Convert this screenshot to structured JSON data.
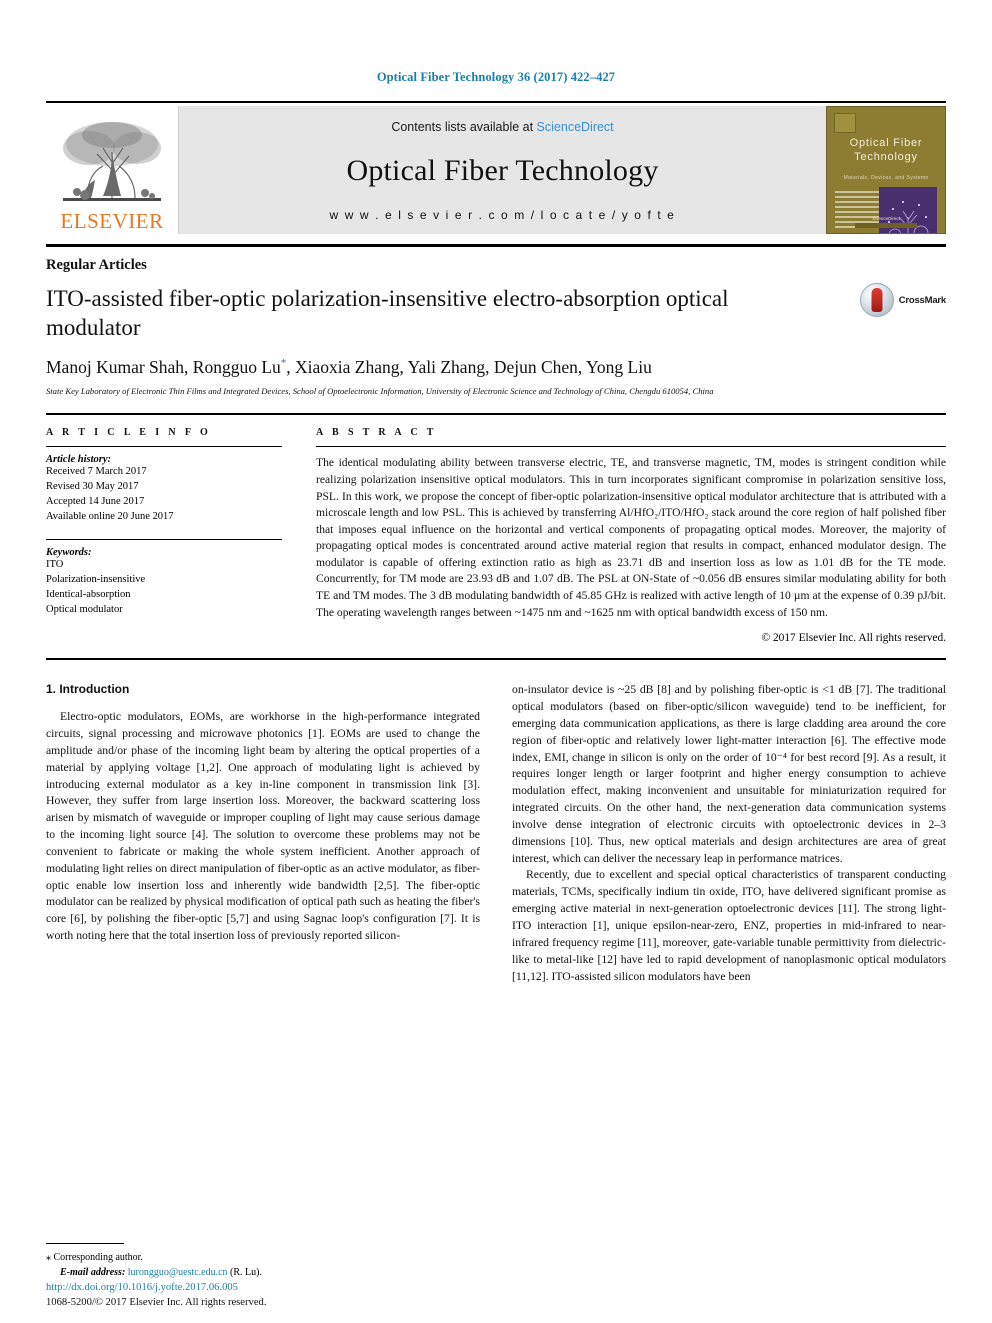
{
  "running_head": "Optical Fiber Technology 36 (2017) 422–427",
  "masthead": {
    "publisher_name": "ELSEVIER",
    "contents_prefix": "Contents lists available at ",
    "contents_link": "ScienceDirect",
    "journal_name": "Optical Fiber Technology",
    "journal_url": "w w w . e l s e v i e r . c o m / l o c a t e / y o f t e",
    "cover": {
      "title_line1": "Optical  Fiber",
      "title_line2": "Technology",
      "subtitle": "Materials, Devices, and Systems",
      "footer": "ScienceDirect"
    }
  },
  "article": {
    "kicker": "Regular Articles",
    "title": "ITO-assisted fiber-optic polarization-insensitive electro-absorption optical modulator",
    "crossmark_label": "CrossMark",
    "authors_pre": "Manoj Kumar Shah, Rongguo Lu",
    "authors_star": "*",
    "authors_post": ", Xiaoxia Zhang, Yali Zhang, Dejun Chen, Yong Liu",
    "affiliation": "State Key Laboratory of Electronic Thin Films and Integrated Devices, School of Optoelectronic Information, University of Electronic Science and Technology of China, Chengdu 610054, China"
  },
  "info": {
    "heading": "A R T I C L E   I N F O",
    "history_label": "Article history:",
    "history": [
      "Received 7 March 2017",
      "Revised 30 May 2017",
      "Accepted 14 June 2017",
      "Available online 20 June 2017"
    ],
    "keywords_label": "Keywords:",
    "keywords": [
      "ITO",
      "Polarization-insensitive",
      "Identical-absorption",
      "Optical modulator"
    ]
  },
  "abstract": {
    "heading": "A B S T R A C T",
    "body": "The identical modulating ability between transverse electric, TE, and transverse magnetic, TM, modes is stringent condition while realizing polarization insensitive optical modulators. This in turn incorporates significant compromise in polarization sensitive loss, PSL. In this work, we propose the concept of fiber-optic polarization-insensitive optical modulator architecture that is attributed with a microscale length and low PSL. This is achieved by transferring Al/HfO₂/ITO/HfO₂ stack around the core region of half polished fiber that imposes equal influence on the horizontal and vertical components of propagating optical modes. Moreover, the majority of propagating optical modes is concentrated around active material region that results in compact, enhanced modulator design. The modulator is capable of offering extinction ratio as high as 23.71 dB and insertion loss as low as 1.01 dB for the TE mode. Concurrently, for TM mode are 23.93 dB and 1.07 dB. The PSL at ON-State of ~0.056 dB ensures similar modulating ability for both TE and TM modes. The 3 dB modulating bandwidth of 45.85 GHz is realized with active length of 10 µm at the expense of 0.39 pJ/bit. The operating wavelength ranges between ~1475 nm and ~1625 nm with optical bandwidth excess of 150 nm.",
    "copyright": "© 2017 Elsevier Inc. All rights reserved."
  },
  "body": {
    "section1_title": "1. Introduction",
    "left_paragraphs": [
      "Electro-optic modulators, EOMs, are workhorse in the high-performance integrated circuits, signal processing and microwave photonics [1]. EOMs are used to change the amplitude and/or phase of the incoming light beam by altering the optical properties of a material by applying voltage [1,2]. One approach of modulating light is achieved by introducing external modulator as a key in-line component in transmission link [3]. However, they suffer from large insertion loss. Moreover, the backward scattering loss arisen by mismatch of waveguide or improper coupling of light may cause serious damage to the incoming light source [4]. The solution to overcome these problems may not be convenient to fabricate or making the whole system inefficient. Another approach of modulating light relies on direct manipulation of fiber-optic as an active modulator, as fiber-optic enable low insertion loss and inherently wide bandwidth [2,5]. The fiber-optic modulator can be realized by physical modification of optical path such as heating the fiber's core [6], by polishing the fiber-optic [5,7] and using Sagnac loop's configuration [7]. It is worth noting here that the total insertion loss of previously reported silicon-"
    ],
    "right_paragraphs": [
      "on-insulator device is ~25 dB [8] and by polishing fiber-optic is <1 dB [7]. The traditional optical modulators (based on fiber-optic/silicon waveguide) tend to be inefficient, for emerging data communication applications, as there is large cladding area around the core region of fiber-optic and relatively lower light-matter interaction [6]. The effective mode index, EMI, change in silicon is only on the order of 10⁻⁴ for best record [9]. As a result, it requires longer length or larger footprint and higher energy consumption to achieve modulation effect, making inconvenient and unsuitable for miniaturization required for integrated circuits. On the other hand, the next-generation data communication systems involve dense integration of electronic circuits with optoelectronic devices in 2–3 dimensions [10]. Thus, new optical materials and design architectures are area of great interest, which can deliver the necessary leap in performance matrices.",
      "Recently, due to excellent and special optical characteristics of transparent conducting materials, TCMs, specifically indium tin oxide, ITO, have delivered significant promise as emerging active material in next-generation optoelectronic devices [11]. The strong light-ITO interaction [1], unique epsilon-near-zero, ENZ, properties in mid-infrared to near-infrared frequency regime [11], moreover, gate-variable tunable permittivity from dielectric-like to metal-like [12] have led to rapid development of nanoplasmonic optical modulators [11,12]. ITO-assisted silicon modulators have been"
    ]
  },
  "footnote": {
    "corresponding_star": "⁎",
    "corresponding_text": "Corresponding author.",
    "email_label": "E-mail address:",
    "email": "lurongguo@uestc.edu.cn",
    "email_suffix": "(R. Lu)."
  },
  "doi_block": {
    "doi": "http://dx.doi.org/10.1016/j.yofte.2017.06.005",
    "issn_line": "1068-5200/© 2017 Elsevier Inc. All rights reserved."
  },
  "colors": {
    "link_blue": "#1a7fa8",
    "sciencedirect_blue": "#3a8fd0",
    "elsevier_orange": "#E87722",
    "cover_olive": "#8d7d33",
    "cover_purple": "#4a2f6e"
  }
}
